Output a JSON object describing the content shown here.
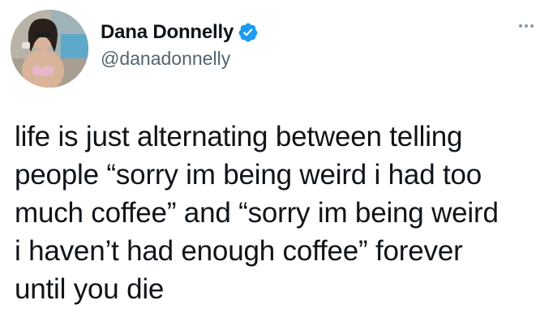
{
  "author": {
    "display_name": "Dana Donnelly",
    "handle": "@danadonnelly",
    "verified": true,
    "avatar_icon": "profile-photo"
  },
  "menu": {
    "icon": "more-options-icon"
  },
  "tweet": {
    "text": "life is just alternating between telling\npeople “sorry im being weird i had too\nmuch coffee” and “sorry im being weird\ni haven’t had enough coffee” forever\nuntil you die"
  },
  "colors": {
    "verified_blue": "#1d9bf0",
    "handle_gray": "#536471",
    "text": "#0f1419"
  }
}
